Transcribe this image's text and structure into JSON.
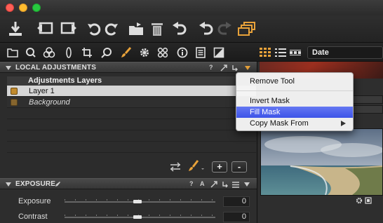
{
  "window": {
    "lights": [
      "#ff5f56",
      "#ffbd2e",
      "#27c93f"
    ]
  },
  "toolbar": {
    "buttons": [
      "import-icon",
      "previous-icon",
      "next-icon",
      "rotate-left-icon",
      "rotate-right-icon",
      "move-to-folder-icon",
      "trash-icon",
      "undo-icon",
      "reset-icon",
      "redo-icon",
      "variants-icon"
    ]
  },
  "tool_tabs": [
    "folder-icon",
    "search-icon",
    "color-icon",
    "lens-icon",
    "crop-icon",
    "zoom-icon",
    "brush-icon",
    "gear-icon",
    "metadata-icon",
    "info-icon",
    "list-icon",
    "contrast-icon"
  ],
  "browser_controls": {
    "sort_field": "Date",
    "view_modes": [
      "grid-view-icon",
      "list-view-icon",
      "filmstrip-view-icon"
    ]
  },
  "local_adjustments": {
    "title": "LOCAL ADJUSTMENTS",
    "header_icons": [
      "?",
      "expand-icon",
      "copy-icon",
      "menu-icon"
    ],
    "layers_header": "Adjustments Layers",
    "layers": [
      {
        "label": "Layer 1",
        "selected": true,
        "italic": false
      },
      {
        "label": "Background",
        "selected": false,
        "italic": true
      }
    ],
    "add_label": "+",
    "remove_label": "-"
  },
  "exposure": {
    "title": "EXPOSURE",
    "header_icons": [
      "?",
      "A"
    ],
    "sliders": [
      {
        "label": "Exposure",
        "value": "0"
      },
      {
        "label": "Contrast",
        "value": "0"
      }
    ]
  },
  "context_menu": {
    "items": [
      {
        "label": "Remove Tool",
        "highlighted": false
      },
      {
        "label": "Invert Mask",
        "highlighted": false
      },
      {
        "label": "Fill Mask",
        "highlighted": true
      },
      {
        "label": "Copy Mask From",
        "highlighted": false,
        "submenu": true
      }
    ]
  },
  "colors": {
    "accent_orange": "#e8a23a",
    "menu_highlight": "#4a5ff0"
  }
}
